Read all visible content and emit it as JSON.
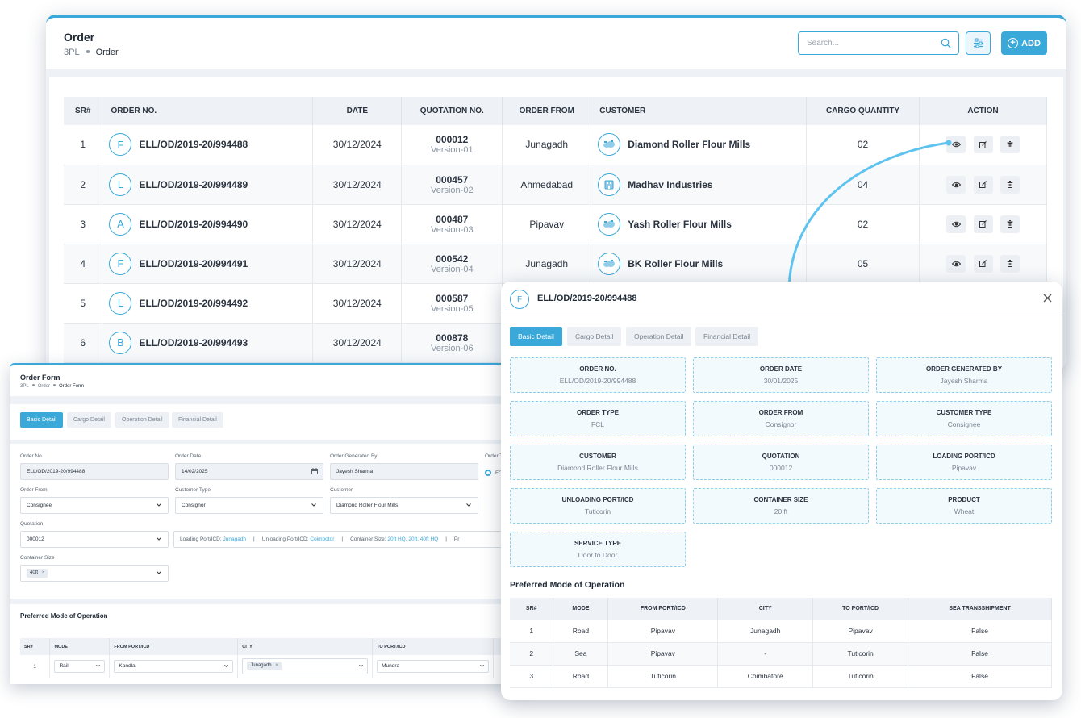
{
  "main": {
    "title": "Order",
    "breadcrumb": [
      "3PL",
      "Order"
    ],
    "search_placeholder": "Search...",
    "add_label": "ADD",
    "columns": [
      "SR#",
      "ORDER NO.",
      "DATE",
      "QUOTATION NO.",
      "ORDER FROM",
      "CUSTOMER",
      "CARGO QUANTITY",
      "ACTION"
    ],
    "rows": [
      {
        "sr": "1",
        "badge": "F",
        "order_no": "ELL/OD/2019-20/994488",
        "date": "30/12/2024",
        "quote": "000012",
        "version": "Version-01",
        "from": "Junagadh",
        "customer": "Diamond Roller Flour Mills",
        "qty": "02"
      },
      {
        "sr": "2",
        "badge": "L",
        "order_no": "ELL/OD/2019-20/994489",
        "date": "30/12/2024",
        "quote": "000457",
        "version": "Version-02",
        "from": "Ahmedabad",
        "customer": "Madhav Industries",
        "qty": "04"
      },
      {
        "sr": "3",
        "badge": "A",
        "order_no": "ELL/OD/2019-20/994490",
        "date": "30/12/2024",
        "quote": "000487",
        "version": "Version-03",
        "from": "Pipavav",
        "customer": "Yash Roller Flour Mills",
        "qty": "02"
      },
      {
        "sr": "4",
        "badge": "F",
        "order_no": "ELL/OD/2019-20/994491",
        "date": "30/12/2024",
        "quote": "000542",
        "version": "Version-04",
        "from": "Junagadh",
        "customer": "BK Roller Flour Mills",
        "qty": "05"
      },
      {
        "sr": "5",
        "badge": "L",
        "order_no": "ELL/OD/2019-20/994492",
        "date": "30/12/2024",
        "quote": "000587",
        "version": "Version-05",
        "from": "",
        "customer": "",
        "qty": ""
      },
      {
        "sr": "6",
        "badge": "B",
        "order_no": "ELL/OD/2019-20/994493",
        "date": "30/12/2024",
        "quote": "000878",
        "version": "Version-06",
        "from": "",
        "customer": "",
        "qty": ""
      }
    ]
  },
  "form": {
    "title": "Order Form",
    "breadcrumb": [
      "3PL",
      "Order",
      "Order Form"
    ],
    "tabs": [
      "Basic Detail",
      "Cargo Detail",
      "Operation Detail",
      "Financial Detail"
    ],
    "order_no_label": "Order No.",
    "order_no_value": "ELL/OD/2019-20/994488",
    "order_date_label": "Order Date",
    "order_date_value": "14/02/2025",
    "generated_by_label": "Order Generated By",
    "generated_by_value": "Jayesh Sharma",
    "order_type_label": "Order T",
    "order_type_value": "FC",
    "order_from_label": "Order From",
    "order_from_value": "Consignee",
    "customer_type_label": "Customer Type",
    "customer_type_value": "Consignor",
    "customer_label": "Customer",
    "customer_value": "Diamond Roller Flour Mills",
    "quotation_label": "Quotation",
    "quotation_value": "000012",
    "info": {
      "loading_label": "Loading Port/ICD:",
      "loading_value": "Junagadh",
      "unloading_label": "Unloading Port/ICD:",
      "unloading_value": "Coimbotor",
      "container_label": "Container Size:",
      "container_value": "20ft HQ, 20ft, 40ft HQ",
      "trailing": "Pr"
    },
    "container_size_label": "Container Size",
    "container_chip": "40ft",
    "pref_title": "Preferred Mode of Operation",
    "pref_columns": [
      "SR#",
      "MODE",
      "FROM PORT/ICD",
      "CITY",
      "TO PORT/ICD"
    ],
    "pref_row": {
      "sr": "1",
      "mode": "Rail",
      "from": "Kandla",
      "city": "Junagadh",
      "to": "Mundra"
    }
  },
  "modal": {
    "badge": "F",
    "title": "ELL/OD/2019-20/994488",
    "tabs": [
      "Basic Detail",
      "Cargo Detail",
      "Operation Detail",
      "Financial Detail"
    ],
    "details": [
      {
        "k": "ORDER NO.",
        "v": "ELL/OD/2019-20/994488"
      },
      {
        "k": "ORDER DATE",
        "v": "30/01/2025"
      },
      {
        "k": "ORDER GENERATED BY",
        "v": "Jayesh Sharma"
      },
      {
        "k": "ORDER TYPE",
        "v": "FCL"
      },
      {
        "k": "ORDER FROM",
        "v": "Consignor"
      },
      {
        "k": "CUSTOMER TYPE",
        "v": "Consignee"
      },
      {
        "k": "CUSTOMER",
        "v": "Diamond Roller Flour Mills"
      },
      {
        "k": "QUOTATION",
        "v": "000012"
      },
      {
        "k": "LOADING PORT/ICD",
        "v": "Pipavav"
      },
      {
        "k": "UNLOADING PORT/ICD",
        "v": "Tuticorin"
      },
      {
        "k": "CONTAINER SIZE",
        "v": "20 ft"
      },
      {
        "k": "PRODUCT",
        "v": "Wheat"
      },
      {
        "k": "SERVICE TYPE",
        "v": "Door to Door"
      }
    ],
    "pref_title": "Preferred Mode of Operation",
    "pref_columns": [
      "SR#",
      "MODE",
      "FROM PORT/ICD",
      "CITY",
      "TO PORT/ICD",
      "SEA TRANSSHIPMENT"
    ],
    "pref_rows": [
      {
        "sr": "1",
        "mode": "Road",
        "from": "Pipavav",
        "city": "Junagadh",
        "to": "Pipavav",
        "sea": "False"
      },
      {
        "sr": "2",
        "mode": "Sea",
        "from": "Pipavav",
        "city": "-",
        "to": "Tuticorin",
        "sea": "False"
      },
      {
        "sr": "3",
        "mode": "Road",
        "from": "Tuticorin",
        "city": "Coimbatore",
        "to": "Tuticorin",
        "sea": "False"
      }
    ]
  },
  "colors": {
    "accent": "#3aa8d8",
    "header_bg": "#eef1f5",
    "text": "#2b3440"
  }
}
